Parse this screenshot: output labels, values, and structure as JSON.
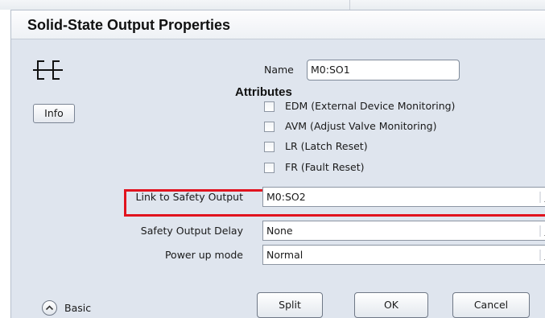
{
  "dialog": {
    "title": "Solid-State Output Properties",
    "name_label": "Name",
    "name_value": "M0:SO1",
    "info_label": "Info",
    "attributes_heading": "Attributes",
    "checkboxes": [
      {
        "label": "EDM (External Device Monitoring)",
        "checked": false
      },
      {
        "label": "AVM (Adjust Valve Monitoring)",
        "checked": false
      },
      {
        "label": "LR (Latch Reset)",
        "checked": false
      },
      {
        "label": "FR (Fault Reset)",
        "checked": false
      }
    ],
    "fields": {
      "link_to_safety_output": {
        "label": "Link to Safety Output",
        "value": "M0:SO2",
        "highlighted": true
      },
      "safety_output_delay": {
        "label": "Safety Output Delay",
        "value": "None"
      },
      "power_up_mode": {
        "label": "Power up mode",
        "value": "Normal"
      }
    },
    "basic_label": "Basic",
    "buttons": {
      "split": "Split",
      "ok": "OK",
      "cancel": "Cancel"
    }
  },
  "colors": {
    "highlight": "#e1131e",
    "dialog_bg": "#dfe5ee"
  },
  "icons": {
    "output_icon": "solid-state-output-ladder-icon",
    "basic_toggle": "chevron-up-circle-icon"
  }
}
